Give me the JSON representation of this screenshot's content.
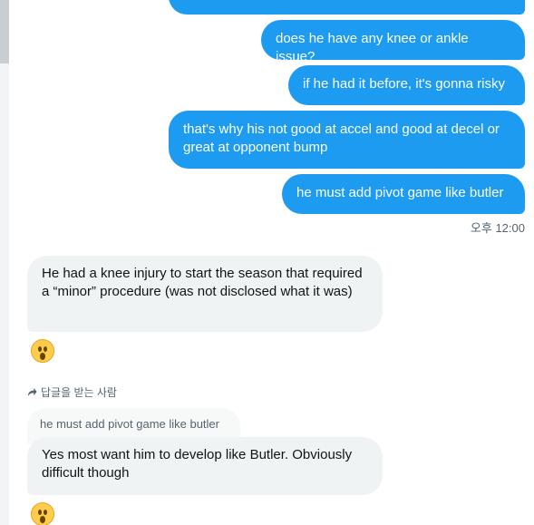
{
  "messages": {
    "sent": [
      {
        "text": "does he have any knee or ankle issue?"
      },
      {
        "text": "if he had it before, it's gonna risky"
      },
      {
        "text": "that's why his not good at accel and good at decel or great at opponent bump"
      },
      {
        "text": "he must add pivot game like butler"
      }
    ],
    "sent_timestamp": "오후 12:00",
    "received": [
      {
        "text": "He had a knee injury to start the season that required a “minor” procedure (was not disclosed what it was)",
        "reaction": "astonished-face-emoji"
      },
      {
        "text": "Yes most want him to develop like Butler. Obviously difficult though",
        "reaction": "astonished-face-emoji"
      }
    ]
  },
  "reply": {
    "label": "답글을 받는 사람",
    "quoted_text": "he must add pivot game like butler"
  },
  "colors": {
    "sent_bubble": "#1d9bf0",
    "received_bubble": "#eff3f4",
    "text_primary": "#0f1419",
    "text_secondary": "#536471"
  }
}
